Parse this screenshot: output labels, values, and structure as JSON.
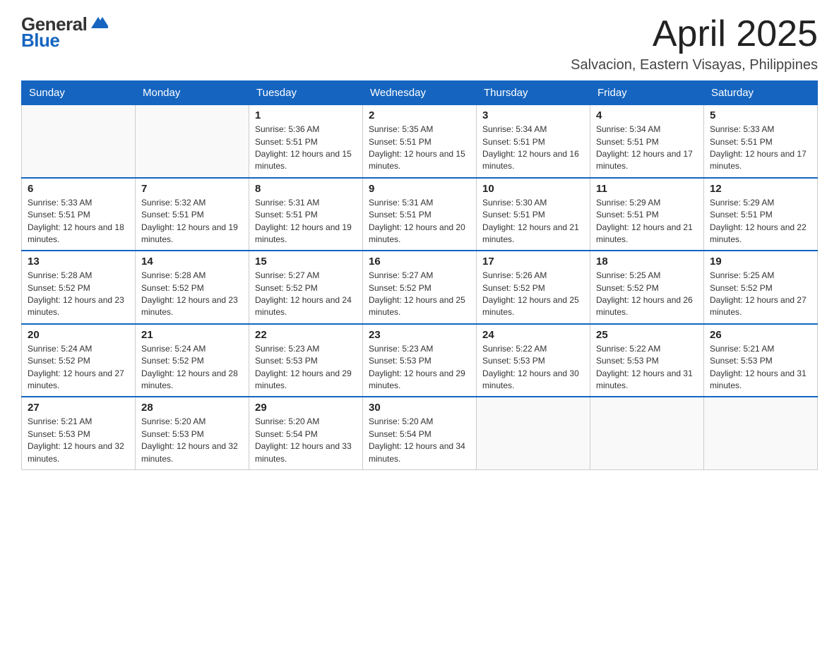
{
  "logo": {
    "text_general": "General",
    "text_blue": "Blue"
  },
  "header": {
    "month": "April 2025",
    "location": "Salvacion, Eastern Visayas, Philippines"
  },
  "days_of_week": [
    "Sunday",
    "Monday",
    "Tuesday",
    "Wednesday",
    "Thursday",
    "Friday",
    "Saturday"
  ],
  "weeks": [
    [
      {
        "day": "",
        "sunrise": "",
        "sunset": "",
        "daylight": ""
      },
      {
        "day": "",
        "sunrise": "",
        "sunset": "",
        "daylight": ""
      },
      {
        "day": "1",
        "sunrise": "Sunrise: 5:36 AM",
        "sunset": "Sunset: 5:51 PM",
        "daylight": "Daylight: 12 hours and 15 minutes."
      },
      {
        "day": "2",
        "sunrise": "Sunrise: 5:35 AM",
        "sunset": "Sunset: 5:51 PM",
        "daylight": "Daylight: 12 hours and 15 minutes."
      },
      {
        "day": "3",
        "sunrise": "Sunrise: 5:34 AM",
        "sunset": "Sunset: 5:51 PM",
        "daylight": "Daylight: 12 hours and 16 minutes."
      },
      {
        "day": "4",
        "sunrise": "Sunrise: 5:34 AM",
        "sunset": "Sunset: 5:51 PM",
        "daylight": "Daylight: 12 hours and 17 minutes."
      },
      {
        "day": "5",
        "sunrise": "Sunrise: 5:33 AM",
        "sunset": "Sunset: 5:51 PM",
        "daylight": "Daylight: 12 hours and 17 minutes."
      }
    ],
    [
      {
        "day": "6",
        "sunrise": "Sunrise: 5:33 AM",
        "sunset": "Sunset: 5:51 PM",
        "daylight": "Daylight: 12 hours and 18 minutes."
      },
      {
        "day": "7",
        "sunrise": "Sunrise: 5:32 AM",
        "sunset": "Sunset: 5:51 PM",
        "daylight": "Daylight: 12 hours and 19 minutes."
      },
      {
        "day": "8",
        "sunrise": "Sunrise: 5:31 AM",
        "sunset": "Sunset: 5:51 PM",
        "daylight": "Daylight: 12 hours and 19 minutes."
      },
      {
        "day": "9",
        "sunrise": "Sunrise: 5:31 AM",
        "sunset": "Sunset: 5:51 PM",
        "daylight": "Daylight: 12 hours and 20 minutes."
      },
      {
        "day": "10",
        "sunrise": "Sunrise: 5:30 AM",
        "sunset": "Sunset: 5:51 PM",
        "daylight": "Daylight: 12 hours and 21 minutes."
      },
      {
        "day": "11",
        "sunrise": "Sunrise: 5:29 AM",
        "sunset": "Sunset: 5:51 PM",
        "daylight": "Daylight: 12 hours and 21 minutes."
      },
      {
        "day": "12",
        "sunrise": "Sunrise: 5:29 AM",
        "sunset": "Sunset: 5:51 PM",
        "daylight": "Daylight: 12 hours and 22 minutes."
      }
    ],
    [
      {
        "day": "13",
        "sunrise": "Sunrise: 5:28 AM",
        "sunset": "Sunset: 5:52 PM",
        "daylight": "Daylight: 12 hours and 23 minutes."
      },
      {
        "day": "14",
        "sunrise": "Sunrise: 5:28 AM",
        "sunset": "Sunset: 5:52 PM",
        "daylight": "Daylight: 12 hours and 23 minutes."
      },
      {
        "day": "15",
        "sunrise": "Sunrise: 5:27 AM",
        "sunset": "Sunset: 5:52 PM",
        "daylight": "Daylight: 12 hours and 24 minutes."
      },
      {
        "day": "16",
        "sunrise": "Sunrise: 5:27 AM",
        "sunset": "Sunset: 5:52 PM",
        "daylight": "Daylight: 12 hours and 25 minutes."
      },
      {
        "day": "17",
        "sunrise": "Sunrise: 5:26 AM",
        "sunset": "Sunset: 5:52 PM",
        "daylight": "Daylight: 12 hours and 25 minutes."
      },
      {
        "day": "18",
        "sunrise": "Sunrise: 5:25 AM",
        "sunset": "Sunset: 5:52 PM",
        "daylight": "Daylight: 12 hours and 26 minutes."
      },
      {
        "day": "19",
        "sunrise": "Sunrise: 5:25 AM",
        "sunset": "Sunset: 5:52 PM",
        "daylight": "Daylight: 12 hours and 27 minutes."
      }
    ],
    [
      {
        "day": "20",
        "sunrise": "Sunrise: 5:24 AM",
        "sunset": "Sunset: 5:52 PM",
        "daylight": "Daylight: 12 hours and 27 minutes."
      },
      {
        "day": "21",
        "sunrise": "Sunrise: 5:24 AM",
        "sunset": "Sunset: 5:52 PM",
        "daylight": "Daylight: 12 hours and 28 minutes."
      },
      {
        "day": "22",
        "sunrise": "Sunrise: 5:23 AM",
        "sunset": "Sunset: 5:53 PM",
        "daylight": "Daylight: 12 hours and 29 minutes."
      },
      {
        "day": "23",
        "sunrise": "Sunrise: 5:23 AM",
        "sunset": "Sunset: 5:53 PM",
        "daylight": "Daylight: 12 hours and 29 minutes."
      },
      {
        "day": "24",
        "sunrise": "Sunrise: 5:22 AM",
        "sunset": "Sunset: 5:53 PM",
        "daylight": "Daylight: 12 hours and 30 minutes."
      },
      {
        "day": "25",
        "sunrise": "Sunrise: 5:22 AM",
        "sunset": "Sunset: 5:53 PM",
        "daylight": "Daylight: 12 hours and 31 minutes."
      },
      {
        "day": "26",
        "sunrise": "Sunrise: 5:21 AM",
        "sunset": "Sunset: 5:53 PM",
        "daylight": "Daylight: 12 hours and 31 minutes."
      }
    ],
    [
      {
        "day": "27",
        "sunrise": "Sunrise: 5:21 AM",
        "sunset": "Sunset: 5:53 PM",
        "daylight": "Daylight: 12 hours and 32 minutes."
      },
      {
        "day": "28",
        "sunrise": "Sunrise: 5:20 AM",
        "sunset": "Sunset: 5:53 PM",
        "daylight": "Daylight: 12 hours and 32 minutes."
      },
      {
        "day": "29",
        "sunrise": "Sunrise: 5:20 AM",
        "sunset": "Sunset: 5:54 PM",
        "daylight": "Daylight: 12 hours and 33 minutes."
      },
      {
        "day": "30",
        "sunrise": "Sunrise: 5:20 AM",
        "sunset": "Sunset: 5:54 PM",
        "daylight": "Daylight: 12 hours and 34 minutes."
      },
      {
        "day": "",
        "sunrise": "",
        "sunset": "",
        "daylight": ""
      },
      {
        "day": "",
        "sunrise": "",
        "sunset": "",
        "daylight": ""
      },
      {
        "day": "",
        "sunrise": "",
        "sunset": "",
        "daylight": ""
      }
    ]
  ]
}
